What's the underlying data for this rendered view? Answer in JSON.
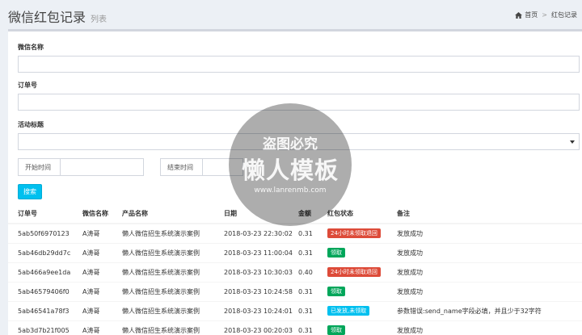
{
  "page": {
    "title": "微信红包记录",
    "subtitle": "列表"
  },
  "breadcrumb": {
    "home": "首页",
    "current": "红包记录"
  },
  "form": {
    "wechat_name_label": "微信名称",
    "order_no_label": "订单号",
    "activity_title_label": "活动标题",
    "start_time_label": "开始时间",
    "end_time_label": "结束时间",
    "search_label": "搜索"
  },
  "table": {
    "headers": [
      "订单号",
      "微信名称",
      "产品名称",
      "日期",
      "金额",
      "红包状态",
      "备注"
    ],
    "rows": [
      {
        "order": "5ab50f6970123",
        "name": "A涛哥",
        "product": "懒人微信招生系统演示案例",
        "date": "2018-03-23 22:30:02",
        "amount": "0.31",
        "status": "24小时未领取退回",
        "note": "发放成功"
      },
      {
        "order": "5ab46db29dd7c",
        "name": "A涛哥",
        "product": "懒人微信招生系统演示案例",
        "date": "2018-03-23 11:00:04",
        "amount": "0.31",
        "status": "领取",
        "note": "发放成功"
      },
      {
        "order": "5ab466a9ee1da",
        "name": "A涛哥",
        "product": "懒人微信招生系统演示案例",
        "date": "2018-03-23 10:30:03",
        "amount": "0.40",
        "status": "24小时未领取退回",
        "note": "发放成功"
      },
      {
        "order": "5ab46579406f0",
        "name": "A涛哥",
        "product": "懒人微信招生系统演示案例",
        "date": "2018-03-23 10:24:58",
        "amount": "0.31",
        "status": "领取",
        "note": "发放成功"
      },
      {
        "order": "5ab46541a78f3",
        "name": "A涛哥",
        "product": "懒人微信招生系统演示案例",
        "date": "2018-03-23 10:24:01",
        "amount": "0.31",
        "status": "已发放,未领取",
        "note": "参数错误:send_name字段必填，并且少于32字符"
      },
      {
        "order": "5ab3d7b21f005",
        "name": "A涛哥",
        "product": "懒人微信招生系统演示案例",
        "date": "2018-03-23 00:20:03",
        "amount": "0.31",
        "status": "领取",
        "note": "发放成功"
      }
    ]
  },
  "status_colors": {
    "24小时未领取退回": "#dd4b39",
    "领取": "#00a65a",
    "已发放,未领取": "#00c0ef"
  },
  "watermark": {
    "line1": "盗图必究",
    "line2": "懒人模板",
    "line3": "www.lanrenmb.com"
  }
}
